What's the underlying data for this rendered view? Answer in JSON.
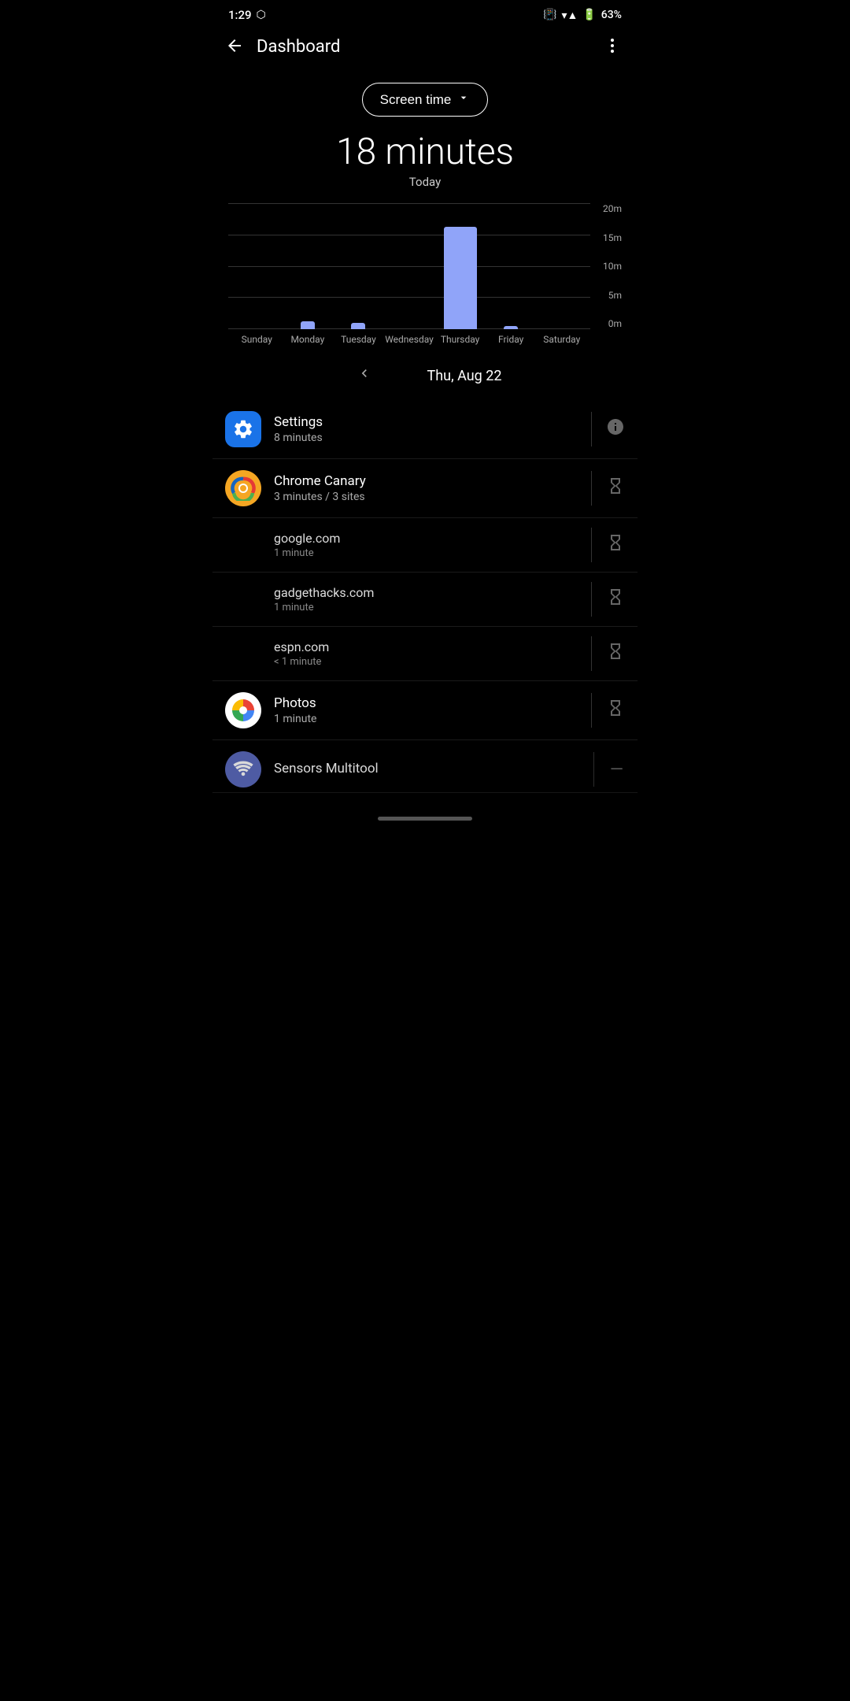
{
  "status": {
    "time": "1:29",
    "battery": "63%",
    "wifi": true,
    "vibrate": true
  },
  "appBar": {
    "title": "Dashboard",
    "backLabel": "←",
    "menuLabel": "⋮"
  },
  "screenTimeButton": {
    "label": "Screen time",
    "dropdownIcon": "▼"
  },
  "totalTime": {
    "value": "18 minutes",
    "period": "Today"
  },
  "chart": {
    "yLabels": [
      "20m",
      "15m",
      "10m",
      "5m",
      "0m"
    ],
    "xLabels": [
      "Sunday",
      "Monday",
      "Tuesday",
      "Wednesday",
      "Thursday",
      "Friday",
      "Saturday"
    ],
    "bars": [
      {
        "day": "Sunday",
        "heightPx": 0,
        "color": "#90a4f9",
        "minutes": 0
      },
      {
        "day": "Monday",
        "heightPx": 10,
        "color": "#90a4f9",
        "minutes": 1
      },
      {
        "day": "Tuesday",
        "heightPx": 8,
        "color": "#90a4f9",
        "minutes": 1
      },
      {
        "day": "Wednesday",
        "heightPx": 0,
        "color": "#90a4f9",
        "minutes": 0
      },
      {
        "day": "Thursday",
        "heightPx": 130,
        "color": "#90a4f9",
        "minutes": 18
      },
      {
        "day": "Friday",
        "heightPx": 4,
        "color": "#90a4f9",
        "minutes": 0
      },
      {
        "day": "Saturday",
        "heightPx": 0,
        "color": "#90a4f9",
        "minutes": 0
      }
    ]
  },
  "dateNav": {
    "prevIcon": "‹",
    "label": "Thu, Aug 22",
    "nextIcon": "›"
  },
  "appList": [
    {
      "id": "settings",
      "name": "Settings",
      "time": "8 minutes",
      "iconType": "settings",
      "actionType": "info",
      "subItems": []
    },
    {
      "id": "chrome-canary",
      "name": "Chrome Canary",
      "time": "3 minutes / 3 sites",
      "iconType": "chrome-canary",
      "actionType": "hourglass",
      "subItems": [
        {
          "name": "google.com",
          "time": "1 minute"
        },
        {
          "name": "gadgethacks.com",
          "time": "1 minute"
        },
        {
          "name": "espn.com",
          "time": "< 1 minute"
        }
      ]
    },
    {
      "id": "photos",
      "name": "Photos",
      "time": "1 minute",
      "iconType": "photos",
      "actionType": "hourglass",
      "subItems": []
    },
    {
      "id": "sensors-multitool",
      "name": "Sensors Multitool",
      "time": "",
      "iconType": "sensor",
      "actionType": "minus",
      "subItems": []
    }
  ],
  "icons": {
    "settings": "⚙",
    "hourglass": "⧗",
    "info": "ℹ",
    "chevron_down": "▾"
  }
}
